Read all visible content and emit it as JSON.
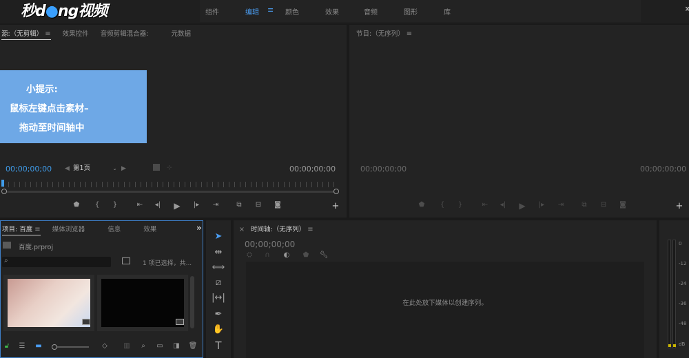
{
  "logo": {
    "text_a": "秒d",
    "text_b": "ng视频"
  },
  "workspace": {
    "tabs": [
      "组件",
      "编辑",
      "颜色",
      "效果",
      "音频",
      "图形",
      "库"
    ],
    "active_index": 1,
    "more_glyph": "»"
  },
  "source_panel": {
    "tabs": [
      "源:（无剪辑）",
      "效果控件",
      "音频剪辑混合器:",
      "元数据"
    ],
    "timecode_in": "00;00;00;00",
    "timecode_out": "00;00;00;00",
    "page_select": "第1页"
  },
  "hint": {
    "title": "小提示:",
    "line1": "鼠标左键点击素材–",
    "line2": "拖动至时间轴中"
  },
  "program_panel": {
    "title": "节目:（无序列）",
    "timecode_in": "00;00;00;00",
    "timecode_out": "00;00;00;00"
  },
  "project_panel": {
    "tabs": [
      "项目: 百度",
      "媒体浏览器",
      "信息",
      "效果"
    ],
    "file_name": "百度.prproj",
    "selection_status": "1 项已选择，共..."
  },
  "timeline_panel": {
    "title": "时间轴:（无序列）",
    "timecode": "00;00;00;00",
    "drop_hint": "在此处放下媒体以创建序列。"
  },
  "meter": {
    "labels": [
      "0",
      "-12",
      "-24",
      "-36",
      "-48",
      "dB"
    ]
  },
  "colors": {
    "accent": "#4a9cf0",
    "hint_bg": "#6ea8e6",
    "panel_bg": "#232323"
  }
}
